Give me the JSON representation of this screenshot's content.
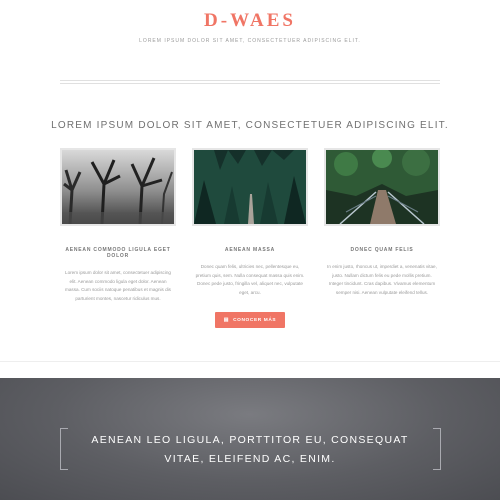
{
  "header": {
    "brand": "D-WAES",
    "tagline": "LOREM IPSUM DOLOR SIT AMET, CONSECTETUER ADIPISCING ELIT."
  },
  "section": {
    "title": "LOREM IPSUM DOLOR SIT AMET, CONSECTETUER ADIPISCING ELIT."
  },
  "cards": [
    {
      "image": "forest-trees-bw",
      "title": "AENEAN COMMODO LIGULA EGET DOLOR",
      "text": "Lorem ipsum dolor sit amet, consectetuer adipiscing elit. Aenean commodo ligula eget dolor. Aenean massa. Cum sociis natoque penatibus et magnis dis parturient montes, nascetur ridiculus mus."
    },
    {
      "image": "forest-path-dark",
      "title": "AENEAN MASSA",
      "text": "Donec quam felis, ultricies nec, pellentesque eu, pretium quis, sem. Nulla consequat massa quis enim. Donec pede justo, fringilla vel, aliquet nec, vulputate eget, arcu."
    },
    {
      "image": "forest-bridge",
      "title": "DONEC QUAM FELIS",
      "text": "In enim justo, rhoncus ut, imperdiet a, venenatis vitae, justo. Nullam dictum felis eu pede mollis pretium. Integer tincidunt. Cras dapibus. Vivamus elementum semper nisi. Aenean vulputate eleifend tellus."
    }
  ],
  "cta": {
    "label": "CONOCER MÁS",
    "icon": "document-icon"
  },
  "banner": {
    "quote": "AENEAN LEO LIGULA, PORTTITOR EU, CONSEQUAT VITAE, ELEIFEND AC, ENIM."
  },
  "colors": {
    "accent": "#f07565",
    "banner": "#5d5e63"
  }
}
